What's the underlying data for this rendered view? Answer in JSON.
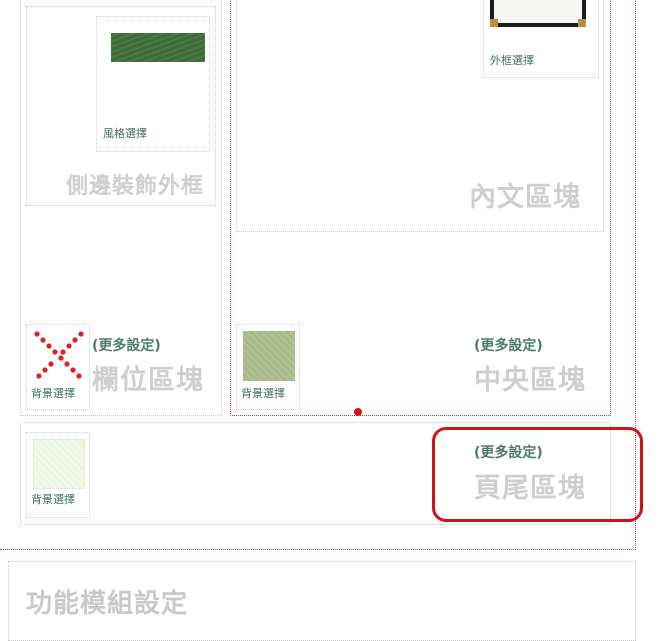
{
  "colors": {
    "accent_text": "#3f6f64",
    "label_gray": "#cccccc",
    "border_red": "#c0392b",
    "highlight_red": "#d0121b"
  },
  "side_frame": {
    "style_caption": "風格選擇",
    "title": "側邊裝飾外框"
  },
  "content": {
    "frame_caption": "外框選擇",
    "title": "內文區塊"
  },
  "column": {
    "more": "(更多設定)",
    "bg_caption": "背景選擇",
    "title": "欄位區塊"
  },
  "center": {
    "more": "(更多設定)",
    "bg_caption": "背景選擇",
    "title": "中央區塊"
  },
  "footer": {
    "more": "(更多設定)",
    "bg_caption": "背景選擇",
    "title": "頁尾區塊"
  },
  "module": {
    "title": "功能模組設定"
  }
}
